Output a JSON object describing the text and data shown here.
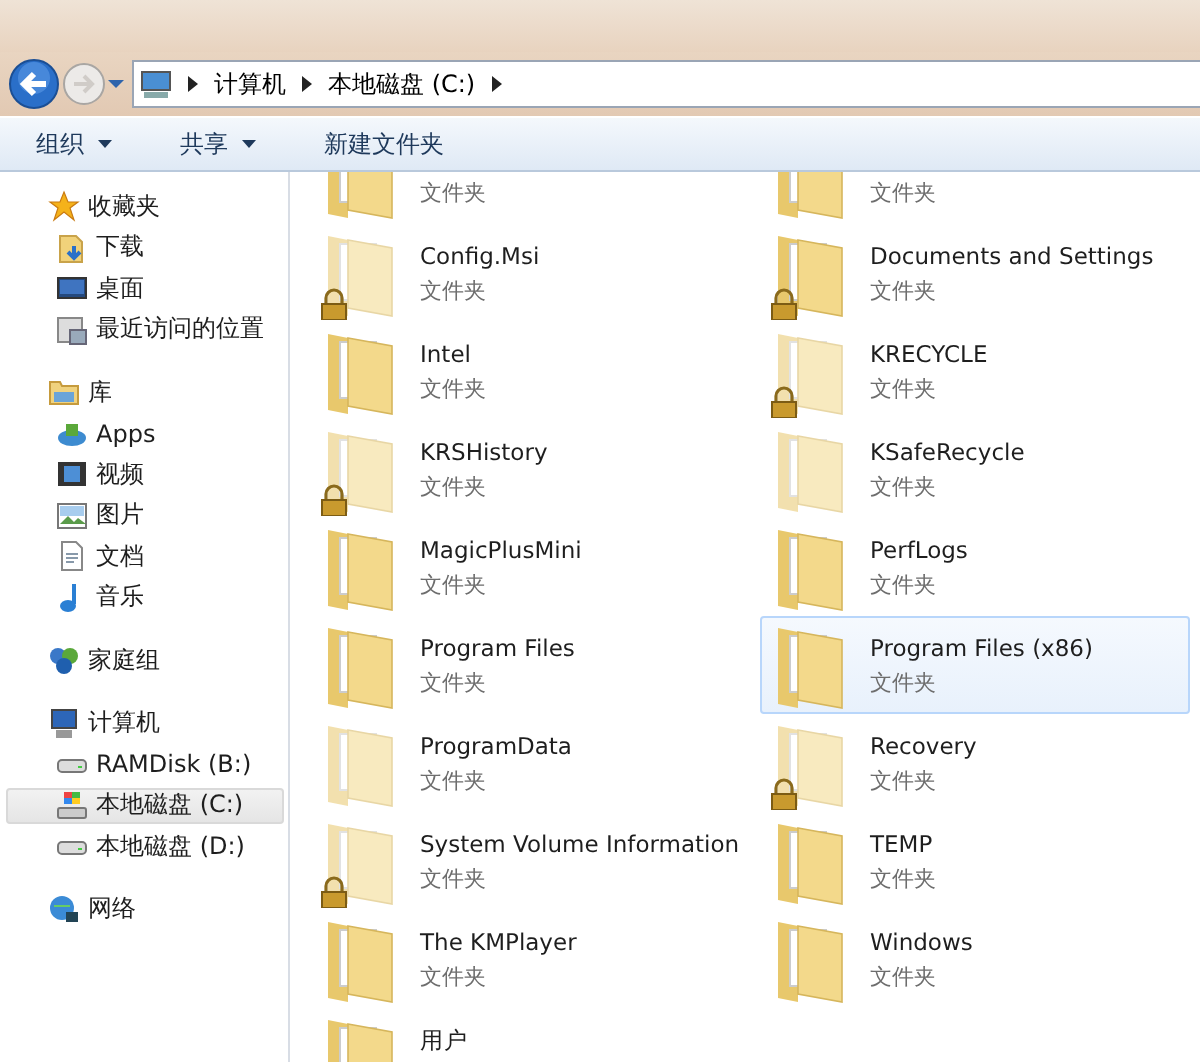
{
  "address_bar": {
    "crumbs": [
      "计算机",
      "本地磁盘 (C:)"
    ]
  },
  "toolbar": {
    "buttons": [
      {
        "label": "组织",
        "dropdown": true
      },
      {
        "label": "共享",
        "dropdown": true
      },
      {
        "label": "新建文件夹",
        "dropdown": false
      }
    ]
  },
  "sidebar": {
    "groups": [
      {
        "label": "收藏夹",
        "kind": "star",
        "children": [
          {
            "label": "下载",
            "kind": "download",
            "selected": false
          },
          {
            "label": "桌面",
            "kind": "desktop",
            "selected": false
          },
          {
            "label": "最近访问的位置",
            "kind": "recent",
            "selected": false
          }
        ]
      },
      {
        "label": "库",
        "kind": "library",
        "children": [
          {
            "label": "Apps",
            "kind": "apps",
            "selected": false
          },
          {
            "label": "视频",
            "kind": "video",
            "selected": false
          },
          {
            "label": "图片",
            "kind": "picture",
            "selected": false
          },
          {
            "label": "文档",
            "kind": "document",
            "selected": false
          },
          {
            "label": "音乐",
            "kind": "music",
            "selected": false
          }
        ]
      },
      {
        "label": "家庭组",
        "kind": "homegroup"
      },
      {
        "label": "计算机",
        "kind": "computer",
        "children": [
          {
            "label": "RAMDisk (B:)",
            "kind": "drive",
            "selected": false
          },
          {
            "label": "本地磁盘 (C:)",
            "kind": "system-drive",
            "selected": true
          },
          {
            "label": "本地磁盘 (D:)",
            "kind": "drive",
            "selected": false
          }
        ]
      },
      {
        "label": "网络",
        "kind": "network"
      }
    ]
  },
  "files": [
    {
      "type": "文件夹",
      "locked": false,
      "hidden": false,
      "selected": false
    },
    {
      "type": "文件夹",
      "locked": false,
      "hidden": false,
      "selected": false
    },
    {
      "name": "Config.Msi",
      "type": "文件夹",
      "locked": true,
      "hidden": true,
      "selected": false
    },
    {
      "name": "Documents and Settings",
      "type": "文件夹",
      "locked": true,
      "hidden": false,
      "selected": false
    },
    {
      "name": "Intel",
      "type": "文件夹",
      "locked": false,
      "hidden": false,
      "selected": false
    },
    {
      "name": "KRECYCLE",
      "type": "文件夹",
      "locked": true,
      "hidden": true,
      "selected": false
    },
    {
      "name": "KRSHistory",
      "type": "文件夹",
      "locked": true,
      "hidden": true,
      "selected": false
    },
    {
      "name": "KSafeRecycle",
      "type": "文件夹",
      "locked": false,
      "hidden": true,
      "selected": false
    },
    {
      "name": "MagicPlusMini",
      "type": "文件夹",
      "locked": false,
      "hidden": false,
      "selected": false
    },
    {
      "name": "PerfLogs",
      "type": "文件夹",
      "locked": false,
      "hidden": false,
      "selected": false
    },
    {
      "name": "Program Files",
      "type": "文件夹",
      "locked": false,
      "hidden": false,
      "selected": false
    },
    {
      "name": "Program Files (x86)",
      "type": "文件夹",
      "locked": false,
      "hidden": false,
      "selected": true
    },
    {
      "name": "ProgramData",
      "type": "文件夹",
      "locked": false,
      "hidden": true,
      "selected": false
    },
    {
      "name": "Recovery",
      "type": "文件夹",
      "locked": true,
      "hidden": true,
      "selected": false
    },
    {
      "name": "System Volume Information",
      "type": "文件夹",
      "locked": true,
      "hidden": true,
      "selected": false
    },
    {
      "name": "TEMP",
      "type": "文件夹",
      "locked": false,
      "hidden": false,
      "selected": false
    },
    {
      "name": "The KMPlayer",
      "type": "文件夹",
      "locked": false,
      "hidden": false,
      "selected": false
    },
    {
      "name": "Windows",
      "type": "文件夹",
      "locked": false,
      "hidden": false,
      "selected": false
    },
    {
      "name": "用户",
      "locked": false,
      "hidden": false,
      "selected": false
    }
  ]
}
